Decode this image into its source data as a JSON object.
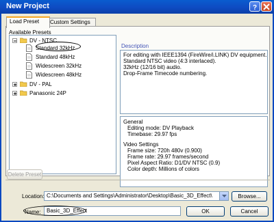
{
  "window": {
    "title": "New Project"
  },
  "tabs": [
    {
      "label": "Load Preset",
      "active": true
    },
    {
      "label": "Custom Settings",
      "active": false
    }
  ],
  "presets": {
    "heading": "Available Presets",
    "tree": [
      {
        "label": "DV - NTSC",
        "expanded": true,
        "type": "folder"
      },
      {
        "label": "Standard 32kHz",
        "type": "file"
      },
      {
        "label": "Standard 48kHz",
        "type": "file"
      },
      {
        "label": "Widescreen 32kHz",
        "type": "file"
      },
      {
        "label": "Widescreen 48kHz",
        "type": "file"
      },
      {
        "label": "DV - PAL",
        "expanded": false,
        "type": "folder"
      },
      {
        "label": "Panasonic 24P",
        "expanded": false,
        "type": "folder"
      }
    ],
    "delete_label": "Delete Preset"
  },
  "description": {
    "heading": "Description",
    "lines": [
      "For editing with IEEE1394 (FireWire/i.LINK) DV equipment.",
      "Standard NTSC video (4:3 interlaced).",
      "32kHz (12/16 bit) audio.",
      "Drop-Frame Timecode numbering."
    ]
  },
  "general": {
    "heading": "General",
    "lines": [
      "Editing mode: DV Playback",
      "Timebase: 29.97 fps"
    ],
    "video_heading": "Video Settings",
    "video_lines": [
      "Frame size: 720h 480v (0.900)",
      "Frame rate: 29.97 frames/second",
      "Pixel Aspect Ratio: D1/DV NTSC (0.9)",
      "Color depth: Millions of colors"
    ]
  },
  "location": {
    "label": "Location:",
    "value": "C:\\Documents and Settings\\Administrator\\Desktop\\Basic_3D_Effect\\",
    "browse_label": "Browse..."
  },
  "name": {
    "label": "Name:",
    "value": "Basic_3D_Effect"
  },
  "buttons": {
    "ok": "OK",
    "cancel": "Cancel"
  },
  "colors": {
    "titlebar": "#0e4bc2",
    "dialog": "#ece9d8",
    "tab_accent": "#f5a623",
    "folder": "#f2c94c"
  }
}
